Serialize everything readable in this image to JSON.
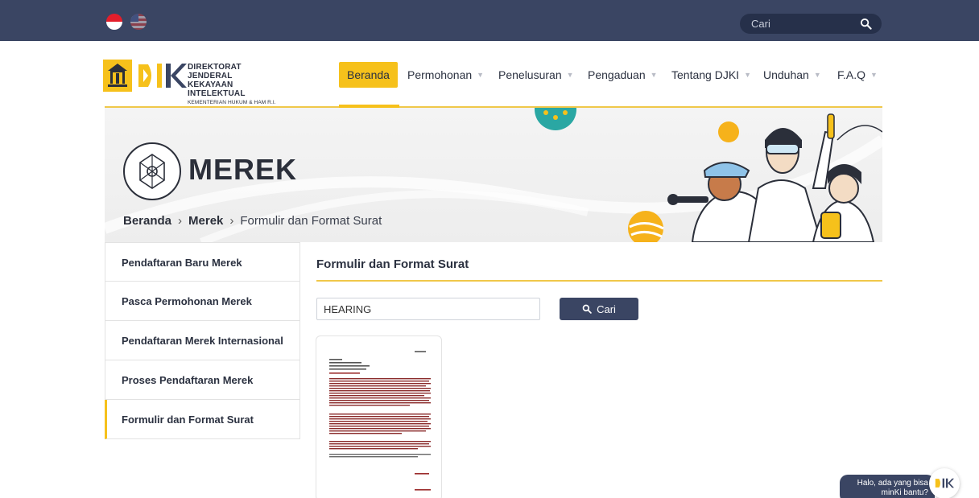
{
  "topbar": {
    "languages": [
      {
        "code": "id",
        "icon": "indonesia-flag-icon"
      },
      {
        "code": "en",
        "icon": "us-flag-icon"
      }
    ],
    "search": {
      "placeholder": "Cari",
      "icon": "search-icon"
    }
  },
  "logo": {
    "line1": "DIREKTORAT JENDERAL",
    "line2": "KEKAYAAN INTELEKTUAL",
    "line3": "KEMENTERIAN HUKUM & HAM R.I.",
    "wordmark": "DJKI"
  },
  "nav": {
    "items": [
      {
        "label": "Beranda",
        "active": true
      },
      {
        "label": "Permohonan"
      },
      {
        "label": "Penelusuran"
      },
      {
        "label": "Pengaduan"
      },
      {
        "label": "Tentang DJKI"
      },
      {
        "label": "Unduhan"
      },
      {
        "label": "F.A.Q"
      }
    ],
    "caret": "▼"
  },
  "banner": {
    "title": "MEREK",
    "breadcrumb": {
      "home": "Beranda",
      "section": "Merek",
      "current": "Formulir dan Format Surat",
      "separator": "›"
    }
  },
  "sidebar": {
    "items": [
      {
        "label": "Pendaftaran Baru Merek"
      },
      {
        "label": "Pasca Permohonan Merek"
      },
      {
        "label": "Pendaftaran Merek Internasional"
      },
      {
        "label": "Proses Pendaftaran Merek"
      },
      {
        "label": "Formulir dan Format Surat",
        "active": true
      }
    ]
  },
  "content": {
    "title": "Formulir dan Format Surat",
    "search_value": "HEARING",
    "search_button": "Cari"
  },
  "chat": {
    "line1": "Halo, ada yang bisa",
    "line2": "minKi bantu?"
  },
  "colors": {
    "navy": "#3a4563",
    "accent": "#f6c11b"
  }
}
